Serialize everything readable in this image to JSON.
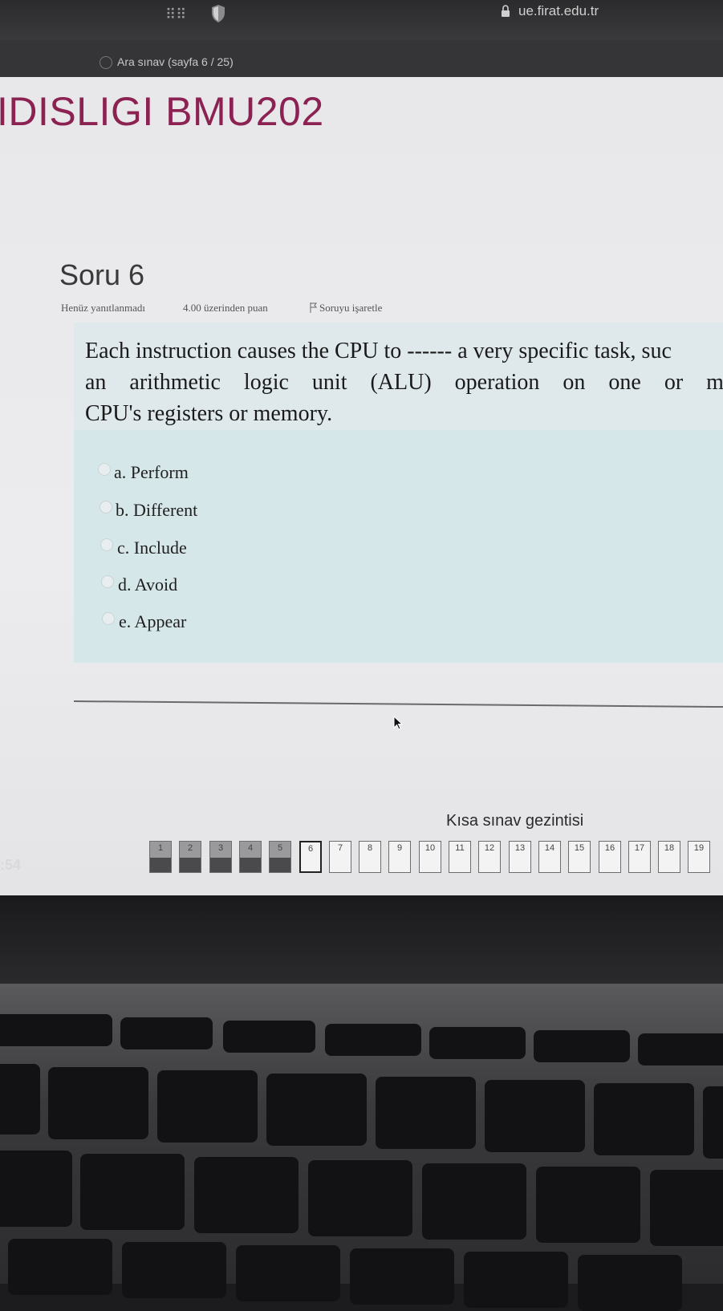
{
  "browser": {
    "url": "ue.firat.edu.tr",
    "tab_title": "Ara sınav (sayfa 6 / 25)"
  },
  "page": {
    "course_title": "IDISLIGI BMU202",
    "question": {
      "heading": "Soru 6",
      "status": "Henüz yanıtlanmadı",
      "points": "4.00 üzerinden puan",
      "flag_label": "Soruyu işaretle",
      "text_lines": [
        "Each instruction causes the CPU to ------ a very specific task, suc",
        "an arithmetic logic unit (ALU) operation on one or mo",
        "CPU's registers or memory."
      ],
      "options": [
        {
          "label": "a. Perform"
        },
        {
          "label": "b. Different"
        },
        {
          "label": "c. Include"
        },
        {
          "label": "d. Avoid"
        },
        {
          "label": "e. Appear"
        }
      ]
    },
    "navigation": {
      "title": "Kısa sınav gezintisi",
      "buttons": [
        {
          "num": "1",
          "state": "answered"
        },
        {
          "num": "2",
          "state": "answered"
        },
        {
          "num": "3",
          "state": "answered"
        },
        {
          "num": "4",
          "state": "answered"
        },
        {
          "num": "5",
          "state": "answered"
        },
        {
          "num": "6",
          "state": "current"
        },
        {
          "num": "7",
          "state": "empty"
        },
        {
          "num": "8",
          "state": "empty"
        },
        {
          "num": "9",
          "state": "empty"
        },
        {
          "num": "10",
          "state": "empty"
        },
        {
          "num": "11",
          "state": "empty"
        },
        {
          "num": "12",
          "state": "empty"
        },
        {
          "num": "13",
          "state": "empty"
        },
        {
          "num": "14",
          "state": "empty"
        },
        {
          "num": "15",
          "state": "empty"
        },
        {
          "num": "16",
          "state": "empty"
        },
        {
          "num": "17",
          "state": "empty"
        },
        {
          "num": "18",
          "state": "empty"
        },
        {
          "num": "19",
          "state": "empty"
        }
      ]
    },
    "timer_partial": ":54"
  }
}
